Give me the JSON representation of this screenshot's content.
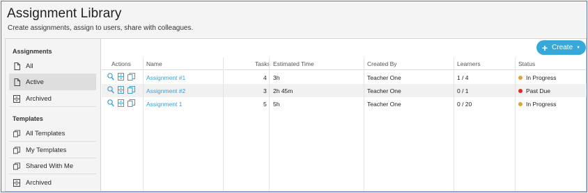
{
  "header": {
    "title": "Assignment Library",
    "subtitle": "Create assignments, assign to users, share with colleagues."
  },
  "sidebar": {
    "assignments_heading": "Assignments",
    "assignments": [
      {
        "label": "All",
        "icon": "document-icon"
      },
      {
        "label": "Active",
        "icon": "document-icon",
        "active": true
      },
      {
        "label": "Archived",
        "icon": "archive-icon"
      }
    ],
    "templates_heading": "Templates",
    "templates": [
      {
        "label": "All Templates",
        "icon": "copy-icon"
      },
      {
        "label": "My Templates",
        "icon": "copy-icon"
      },
      {
        "label": "Shared With Me",
        "icon": "copy-icon"
      },
      {
        "label": "Archived",
        "icon": "archive-icon"
      }
    ]
  },
  "toolbar": {
    "create_label": "Create"
  },
  "table": {
    "columns": [
      "Actions",
      "Name",
      "Tasks",
      "Estimated Time",
      "Created By",
      "Learners",
      "Status"
    ],
    "rows": [
      {
        "name": "Assignment #1",
        "tasks": "4",
        "time": "3h",
        "created_by": "Teacher One",
        "learners": "1 / 4",
        "status": "In Progress",
        "status_color": "#e0a43a"
      },
      {
        "name": "Assignment #2",
        "tasks": "3",
        "time": "2h 45m",
        "created_by": "Teacher One",
        "learners": "0 / 1",
        "status": "Past Due",
        "status_color": "#e02b1f"
      },
      {
        "name": "Assignment 1",
        "tasks": "5",
        "time": "5h",
        "created_by": "Teacher One",
        "learners": "0 / 20",
        "status": "In Progress",
        "status_color": "#e0a43a"
      }
    ]
  },
  "colors": {
    "accent": "#38a8d8",
    "link": "#3a9fd0"
  }
}
